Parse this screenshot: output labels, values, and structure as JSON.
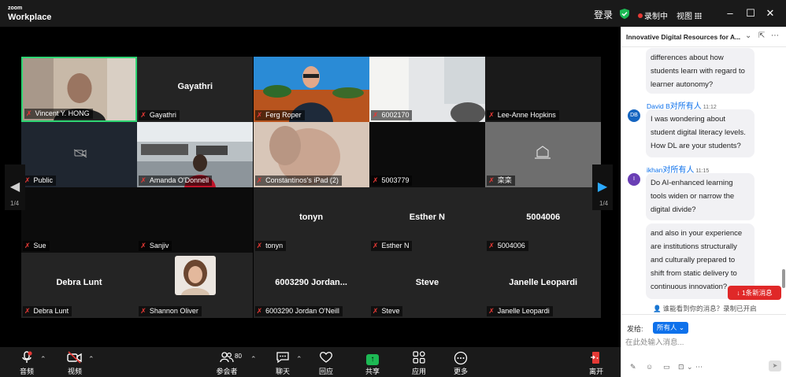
{
  "app": {
    "logo_small": "zoom",
    "logo_big": "Workplace"
  },
  "titlebar": {
    "login": "登录",
    "recording": "录制中",
    "view": "视图",
    "minimize": "–",
    "maximize": "☐",
    "close": "✕"
  },
  "tiles": [
    {
      "name": "Vincent Y. HONG",
      "center": "",
      "video": "vincent",
      "active": true
    },
    {
      "name": "Gayathri",
      "center": "Gayathri",
      "video": ""
    },
    {
      "name": "Ferg Roper",
      "center": "",
      "video": "ferg"
    },
    {
      "name": "6002170",
      "center": "",
      "video": "room"
    },
    {
      "name": "Lee-Anne Hopkins",
      "center": "",
      "video": "dark"
    },
    {
      "name": "Public",
      "center": "",
      "video": "camoff"
    },
    {
      "name": "Amanda O'Donnell",
      "center": "",
      "video": "office"
    },
    {
      "name": "Constantinos's iPad (2)",
      "center": "",
      "video": "blur"
    },
    {
      "name": "5003779",
      "center": "",
      "video": "black"
    },
    {
      "name": "栾栾",
      "center": "",
      "video": "gray"
    },
    {
      "name": "Sue",
      "center": "",
      "video": "black"
    },
    {
      "name": "Sanjiv",
      "center": "",
      "video": "black"
    },
    {
      "name": "tonyn",
      "center": "tonyn",
      "video": ""
    },
    {
      "name": "Esther N",
      "center": "Esther N",
      "video": ""
    },
    {
      "name": "5004006",
      "center": "5004006",
      "video": ""
    },
    {
      "name": "Debra Lunt",
      "center": "Debra Lunt",
      "video": ""
    },
    {
      "name": "Shannon Oliver",
      "center": "",
      "video": "avatar"
    },
    {
      "name": "6003290 Jordan O'Neill",
      "center": "6003290 Jordan...",
      "video": ""
    },
    {
      "name": "Steve",
      "center": "Steve",
      "video": ""
    },
    {
      "name": "Janelle Leopardi",
      "center": "Janelle Leopardi",
      "video": ""
    }
  ],
  "pager": {
    "left": "1/4",
    "right": "1/4"
  },
  "toolbar": {
    "audio": "音频",
    "video": "视频",
    "participants": "参会者",
    "participants_count": "80",
    "chat": "聊天",
    "react": "回应",
    "share": "共享",
    "apps": "应用",
    "more": "更多",
    "leave": "离开"
  },
  "chat": {
    "title": "Innovative Digital Resources for A...",
    "messages": [
      {
        "text": "differences about how students learn with regard to learner autonomy?"
      },
      {
        "sender": "David B",
        "to": "所有人",
        "time": "11:12",
        "avatar": "DB",
        "avatar_color": "#1565c0",
        "text": "I was wondering about student digital literacy levels. How DL are your students?"
      },
      {
        "sender": "ikhan",
        "to": "所有人",
        "time": "11:15",
        "avatar": "I",
        "avatar_color": "#6a3fb5",
        "text": "Do AI-enhanced learning tools widen or narrow the digital divide?"
      },
      {
        "text": "and also in your experience are institutions structurally and culturally prepared to shift from static delivery to continuous innovation?"
      }
    ],
    "to_prefix": "对",
    "new_messages": "1条新消息",
    "who_can_see": "谁能看到你的消息？录制已开启",
    "send_to_label": "发给:",
    "send_to_value": "所有人",
    "input_placeholder": "在此处输入消息..."
  },
  "colors": {
    "active_border": "#2ed573",
    "accent": "#0e71eb",
    "muted_mic": "#e53935",
    "new_msg": "#e02828"
  }
}
